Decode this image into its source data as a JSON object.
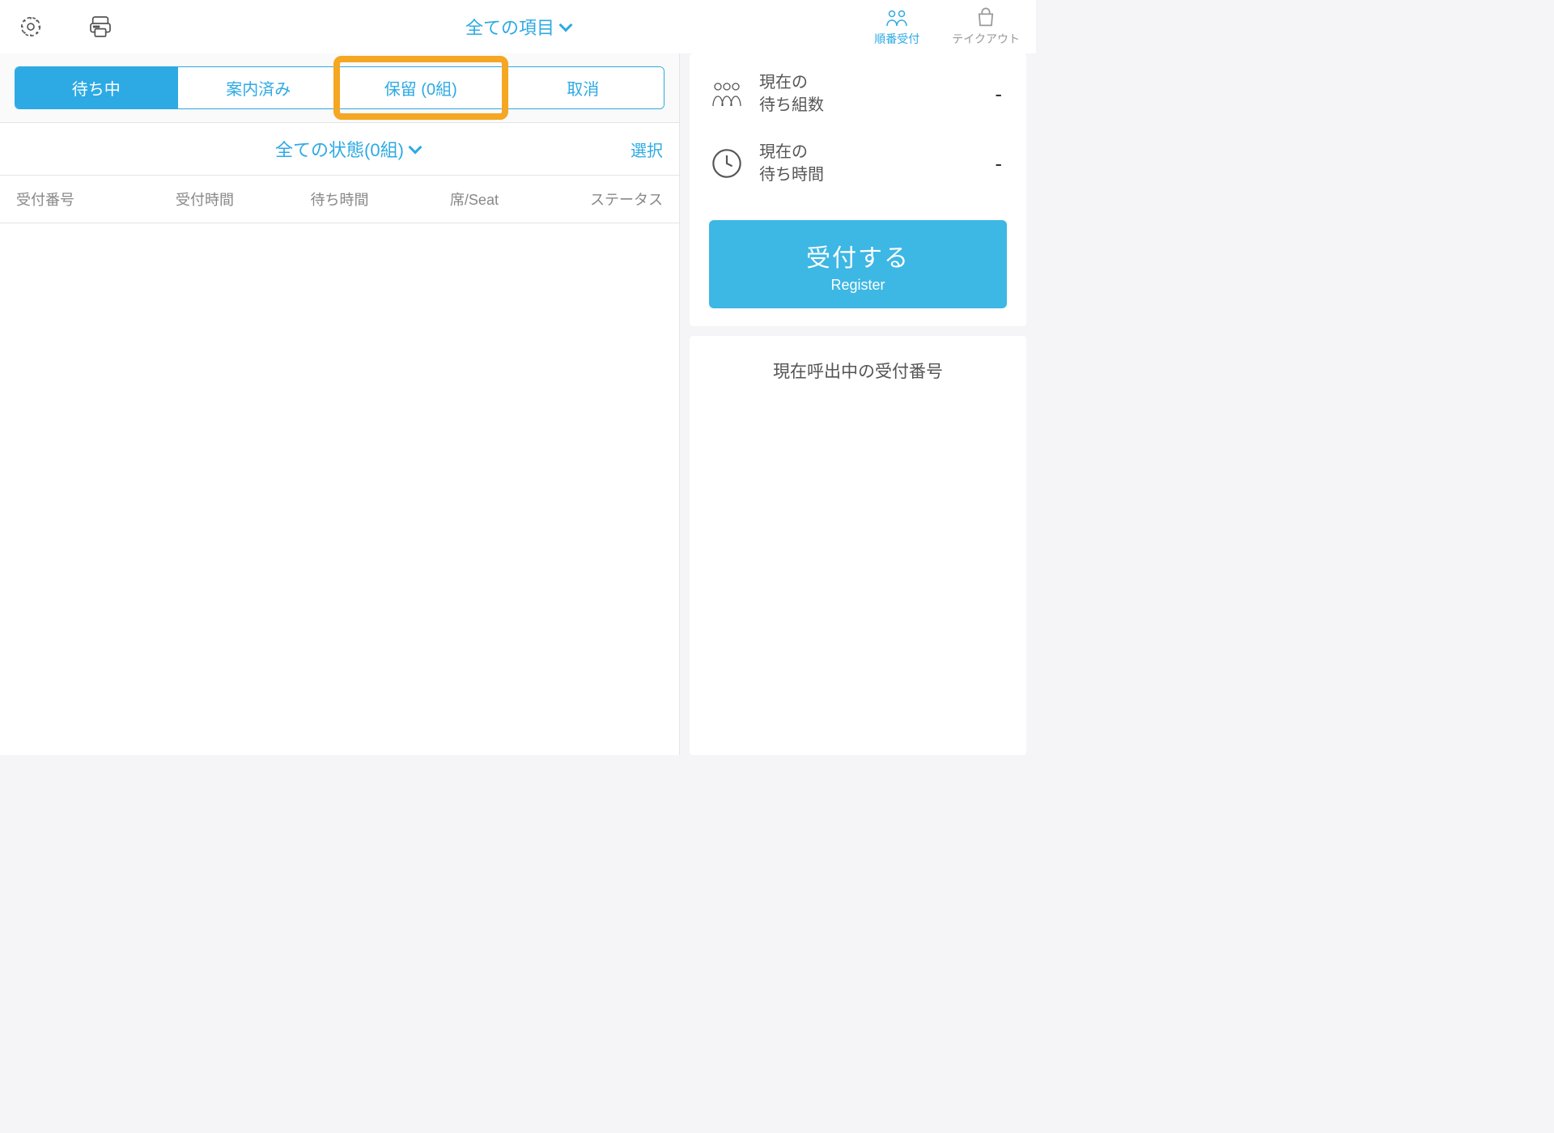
{
  "header": {
    "title": "全ての項目",
    "modes": {
      "queue": "順番受付",
      "takeout": "テイクアウト"
    }
  },
  "tabs": {
    "waiting": "待ち中",
    "guided": "案内済み",
    "hold": "保留 (0組)",
    "cancel": "取消"
  },
  "filter": {
    "status_label": "全ての状態(0組)",
    "select_label": "選択"
  },
  "columns": {
    "number": "受付番号",
    "time": "受付時間",
    "wait": "待ち時間",
    "seat": "席/Seat",
    "status": "ステータス"
  },
  "stats": {
    "count_label_1": "現在の",
    "count_label_2": "待ち組数",
    "count_value": "-",
    "time_label_1": "現在の",
    "time_label_2": "待ち時間",
    "time_value": "-"
  },
  "register": {
    "jp": "受付する",
    "en": "Register"
  },
  "calling": {
    "title": "現在呼出中の受付番号"
  }
}
